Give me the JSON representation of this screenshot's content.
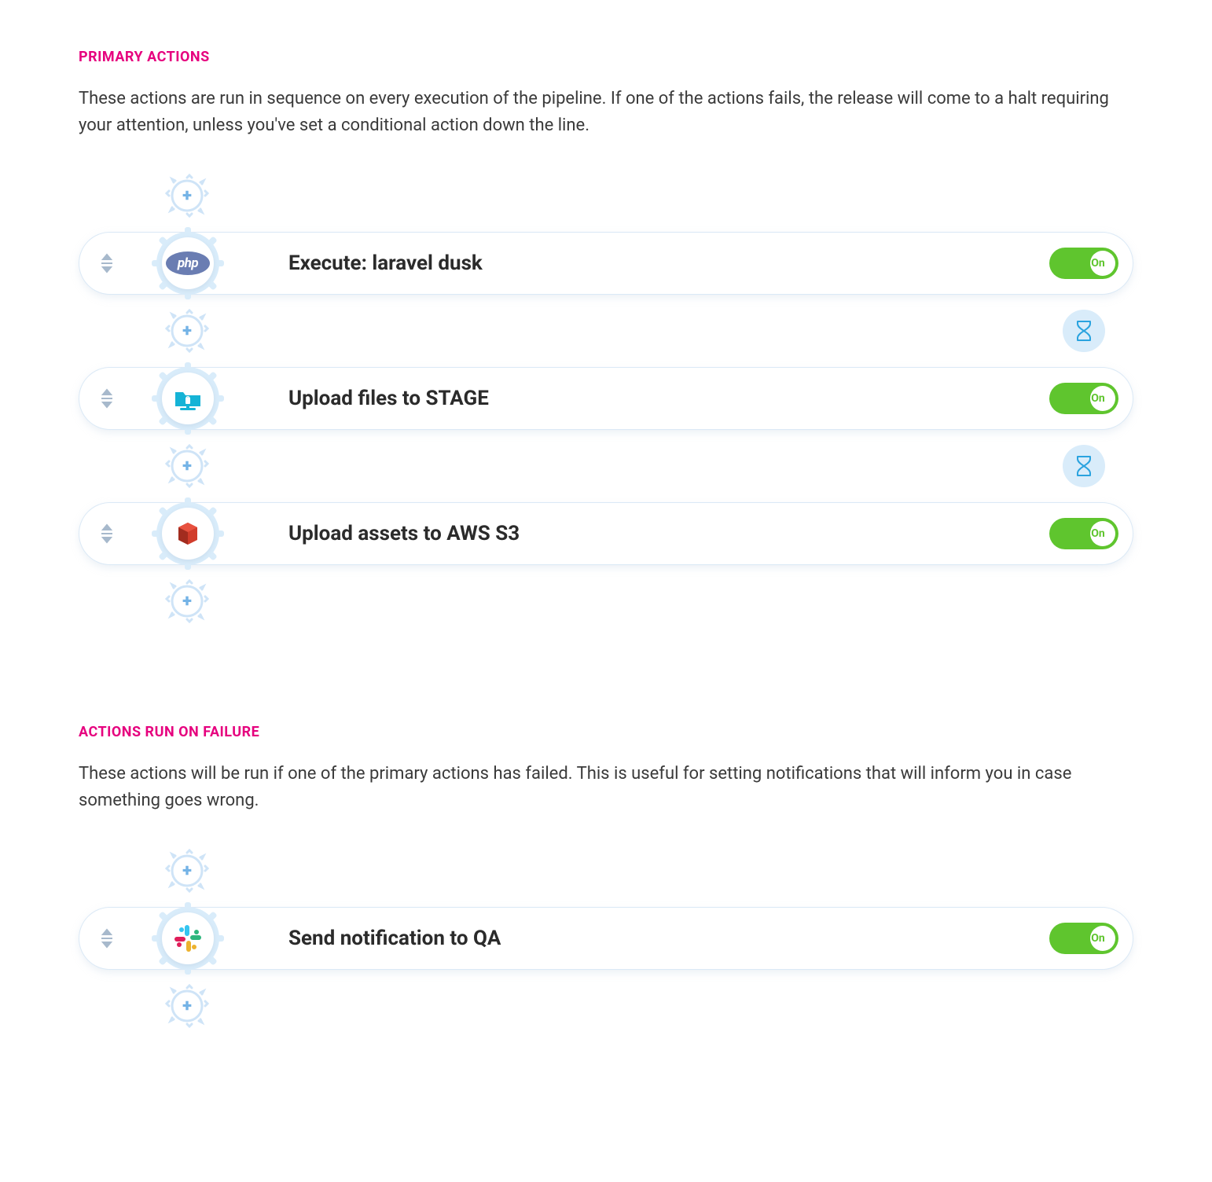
{
  "sections": {
    "primary": {
      "title": "PRIMARY ACTIONS",
      "description": "These actions are run in sequence on every execution of the pipeline. If one of the actions fails, the release will come to a halt requiring your attention, unless you've set a conditional action down the line."
    },
    "failure": {
      "title": "ACTIONS RUN ON FAILURE",
      "description": "These actions will be run if one of the primary actions has failed. This is useful for setting notifications that will inform you in case something goes wrong."
    }
  },
  "toggle_on_label": "On",
  "primary_actions": [
    {
      "label": "Execute: laravel dusk",
      "icon": "php",
      "on": true
    },
    {
      "label": "Upload files to STAGE",
      "icon": "sftp",
      "on": true
    },
    {
      "label": "Upload assets to AWS S3",
      "icon": "aws",
      "on": true
    }
  ],
  "failure_actions": [
    {
      "label": "Send notification to QA",
      "icon": "slack",
      "on": true
    }
  ]
}
